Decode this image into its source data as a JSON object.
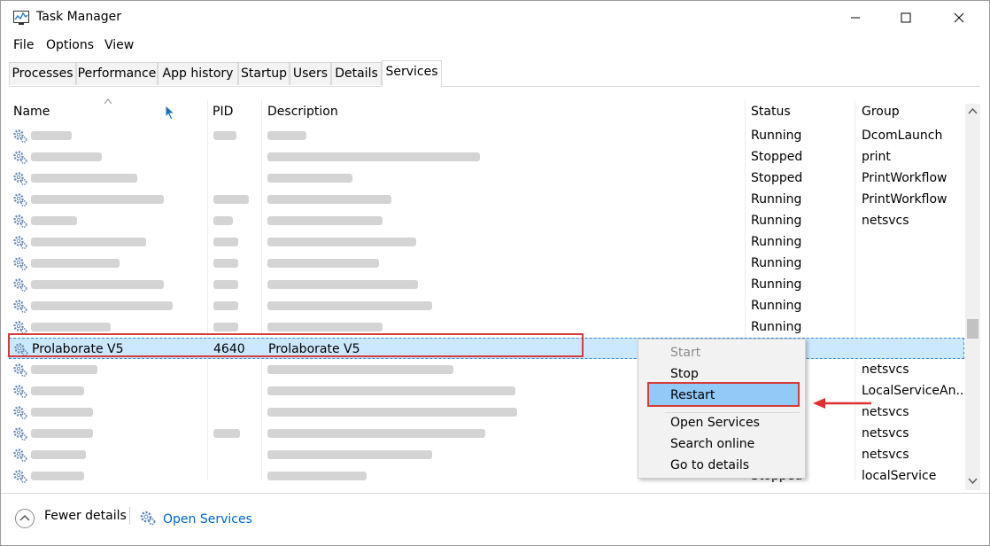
{
  "window": {
    "title": "Task Manager",
    "controls": [
      "minimize",
      "maximize",
      "close"
    ]
  },
  "menu": [
    "File",
    "Options",
    "View"
  ],
  "tabs": [
    "Processes",
    "Performance",
    "App history",
    "Startup",
    "Users",
    "Details",
    "Services"
  ],
  "active_tab": "Services",
  "columns": {
    "name": "Name",
    "pid": "PID",
    "description": "Description",
    "status": "Status",
    "group": "Group"
  },
  "rows": [
    {
      "status": "Running",
      "group": "DcomLaunch"
    },
    {
      "status": "Stopped",
      "group": "print"
    },
    {
      "status": "Stopped",
      "group": "PrintWorkflow"
    },
    {
      "status": "Running",
      "group": "PrintWorkflow"
    },
    {
      "status": "Running",
      "group": "netsvcs"
    },
    {
      "status": "Running",
      "group": ""
    },
    {
      "status": "Running",
      "group": ""
    },
    {
      "status": "Running",
      "group": ""
    },
    {
      "status": "Running",
      "group": ""
    },
    {
      "status": "Running",
      "group": ""
    },
    {
      "name": "Prolaborate V5",
      "pid": "4640",
      "description": "Prolaborate V5",
      "status": "",
      "group": ""
    },
    {
      "status": "",
      "group": "netsvcs"
    },
    {
      "status": "",
      "group": "LocalServiceAn..."
    },
    {
      "status": "",
      "group": "netsvcs"
    },
    {
      "status": "",
      "group": "netsvcs"
    },
    {
      "status": "",
      "group": "netsvcs"
    },
    {
      "status": "Stopped",
      "group": "localService"
    }
  ],
  "context_menu": {
    "start": "Start",
    "stop": "Stop",
    "restart": "Restart",
    "open_services": "Open Services",
    "search_online": "Search online",
    "go_to_details": "Go to details"
  },
  "footer": {
    "fewer_details": "Fewer details",
    "open_services": "Open Services"
  },
  "colors": {
    "selection": "#cce8ff",
    "annotation_red": "#d43c3c",
    "link_blue": "#0066cc",
    "menu_highlight": "#91c9f7"
  }
}
